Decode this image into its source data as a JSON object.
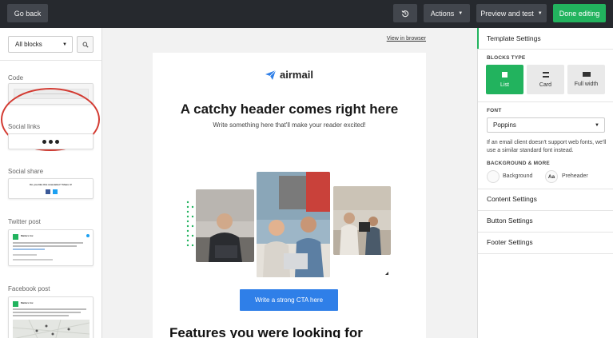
{
  "topbar": {
    "go_back": "Go back",
    "actions": "Actions",
    "preview": "Preview and test",
    "done": "Done editing"
  },
  "sidebar": {
    "filter_value": "All blocks",
    "blocks": [
      {
        "label": "Code"
      },
      {
        "label": "Social links"
      },
      {
        "label": "Social share",
        "share_text": "Do you like this newsletter? Share it!"
      },
      {
        "label": "Twitter post",
        "account": "Mailers Inc"
      },
      {
        "label": "Facebook post",
        "account": "Mailers Inc"
      }
    ]
  },
  "canvas": {
    "view_link": "View in browser",
    "logo": "airmail",
    "headline": "A catchy header comes right here",
    "subline": "Write something here that'll make your reader excited!",
    "cta": "Write a strong CTA here",
    "features": "Features you were looking for"
  },
  "settings": {
    "title": "Template Settings",
    "blocks_type_label": "BLOCKS TYPE",
    "block_types": [
      "List",
      "Card",
      "Full width"
    ],
    "font_label": "FONT",
    "font_value": "Poppins",
    "font_note": "If an email client doesn't support web fonts, we'll use a similar standard font instead.",
    "bg_label": "BACKGROUND & MORE",
    "background": "Background",
    "preheader_icon": "Aa",
    "preheader": "Preheader",
    "sections": [
      "Content Settings",
      "Button Settings",
      "Footer Settings"
    ]
  },
  "colors": {
    "topbar": "#26292e",
    "accent_green": "#22b35e",
    "cta_blue": "#2f7fe8",
    "highlight_red": "#d33b32"
  }
}
